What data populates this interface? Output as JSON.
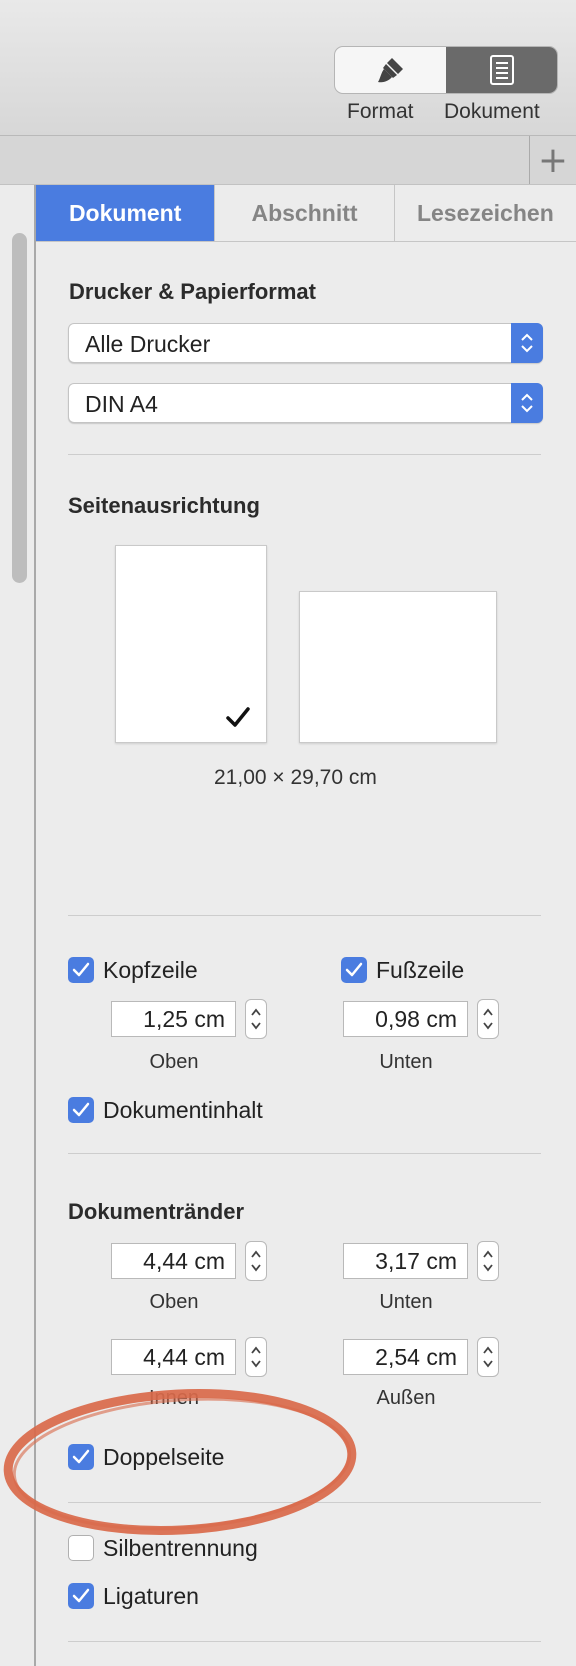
{
  "toolbar": {
    "format_label": "Format",
    "document_label": "Dokument",
    "format_icon": "paintbrush-icon",
    "document_icon": "document-icon",
    "add_icon": "plus-icon"
  },
  "tabs": [
    {
      "label": "Dokument",
      "active": true
    },
    {
      "label": "Abschnitt",
      "active": false
    },
    {
      "label": "Lesezeichen",
      "active": false
    }
  ],
  "printer": {
    "title": "Drucker & Papierformat",
    "printer_value": "Alle Drucker",
    "paper_value": "DIN A4"
  },
  "orientation": {
    "title": "Seitenausrichtung",
    "selected": "portrait",
    "size_text": "21,00 × 29,70 cm"
  },
  "header_footer": {
    "header": {
      "label": "Kopfzeile",
      "checked": true,
      "value": "1,25 cm",
      "caption": "Oben"
    },
    "footer": {
      "label": "Fußzeile",
      "checked": true,
      "value": "0,98 cm",
      "caption": "Unten"
    },
    "body": {
      "label": "Dokumentinhalt",
      "checked": true
    }
  },
  "margins": {
    "title": "Dokumentränder",
    "top": {
      "value": "4,44 cm",
      "caption": "Oben"
    },
    "bottom": {
      "value": "3,17 cm",
      "caption": "Unten"
    },
    "inner": {
      "value": "4,44 cm",
      "caption": "Innen"
    },
    "outer": {
      "value": "2,54 cm",
      "caption": "Außen"
    },
    "facing_pages": {
      "label": "Doppelseite",
      "checked": true
    }
  },
  "options": {
    "hyphenation": {
      "label": "Silbentrennung",
      "checked": false
    },
    "ligatures": {
      "label": "Ligaturen",
      "checked": true
    }
  },
  "colors": {
    "accent": "#4a7ce0",
    "annotation": "#d9694a"
  }
}
